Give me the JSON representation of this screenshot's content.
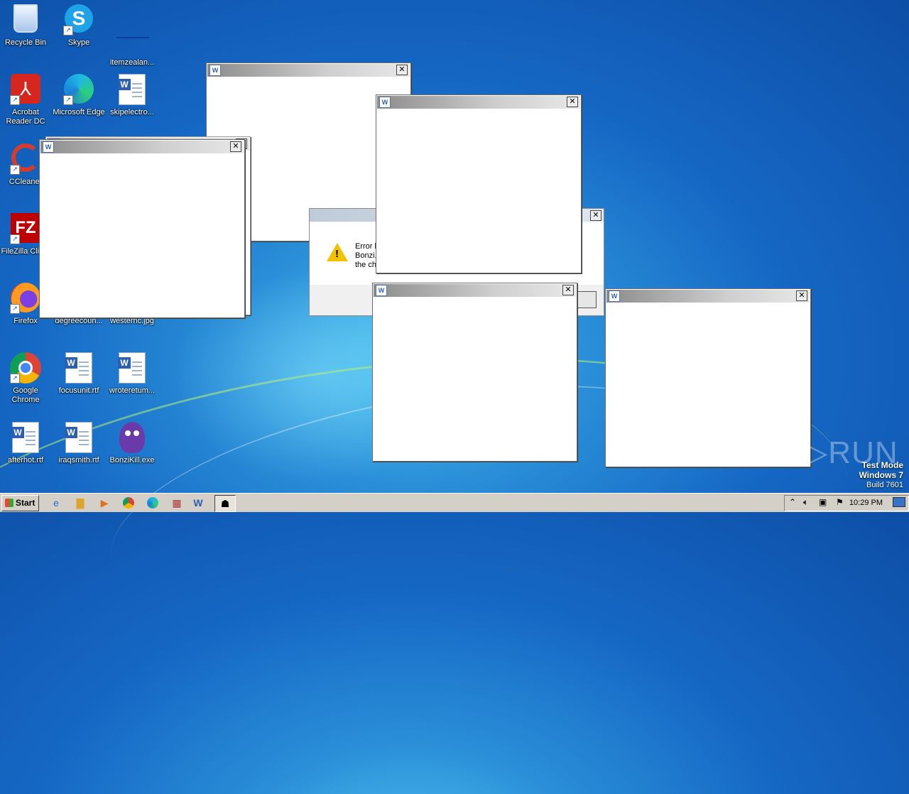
{
  "desktop": {
    "icons": [
      {
        "label": "Recycle Bin",
        "icon": "recycle-bin-icon"
      },
      {
        "label": "Skype",
        "icon": "skype-icon"
      },
      {
        "label": "itemzealan...",
        "icon": "file-icon"
      },
      {
        "label": "Acrobat Reader DC",
        "icon": "acrobat-icon"
      },
      {
        "label": "Microsoft Edge",
        "icon": "edge-icon"
      },
      {
        "label": "skipelectro...",
        "icon": "word-doc-icon"
      },
      {
        "label": "CCleaner",
        "icon": "ccleaner-icon"
      },
      {
        "label": "FileZilla Client",
        "icon": "filezilla-icon"
      },
      {
        "label": "Firefox",
        "icon": "firefox-icon"
      },
      {
        "label": "degreecoun...",
        "icon": "file-icon"
      },
      {
        "label": "westernc.jpg",
        "icon": "image-icon"
      },
      {
        "label": "Google Chrome",
        "icon": "chrome-icon"
      },
      {
        "label": "focusunit.rtf",
        "icon": "word-doc-icon"
      },
      {
        "label": "wroteretum...",
        "icon": "word-doc-icon"
      },
      {
        "label": "afterhot.rtf",
        "icon": "word-doc-icon"
      },
      {
        "label": "iraqsmith.rtf",
        "icon": "word-doc-icon"
      },
      {
        "label": "BonziKill.exe",
        "icon": "bonzi-icon"
      }
    ]
  },
  "error_dialog": {
    "message_lines": [
      "Error l",
      "Bonzi.",
      "the ch"
    ]
  },
  "windows": {
    "close_glyph": "✕",
    "icon_glyph": "W"
  },
  "taskbar": {
    "start_label": "Start",
    "clock": "10:29 PM",
    "tray_chevron": "⌃"
  },
  "watermark": {
    "line1": "Test Mode",
    "line2": "Windows 7",
    "line3": "Build 7601",
    "brand": "ANY▷RUN"
  }
}
